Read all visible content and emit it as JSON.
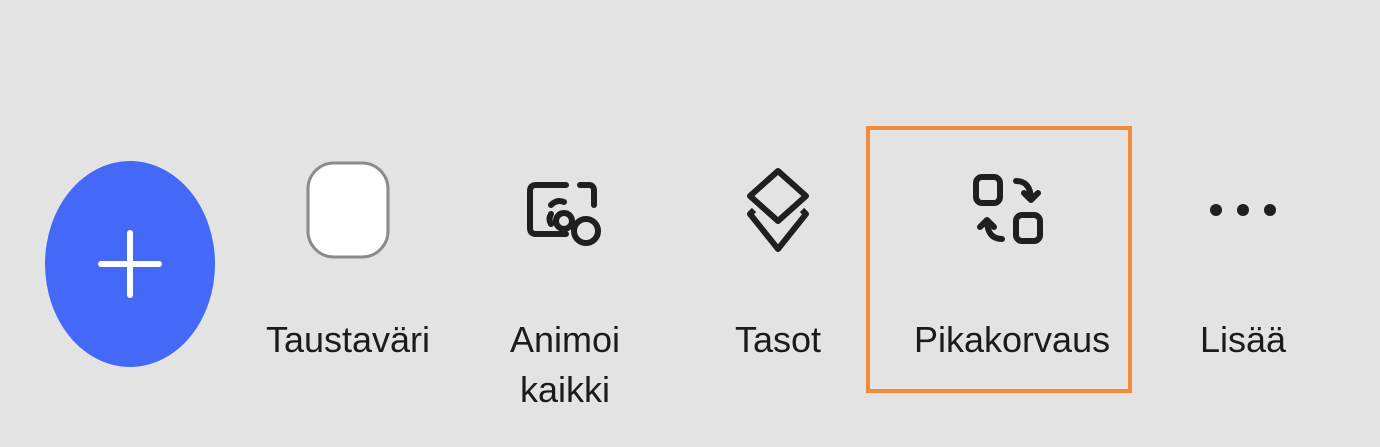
{
  "colors": {
    "background": "#e3e3e3",
    "add_button": "#4468f7",
    "highlight": "#f38a3a",
    "icon": "#1f1f1f"
  },
  "add_button": {
    "icon": "plus-icon"
  },
  "toolbar": {
    "items": [
      {
        "label_lines": [
          "Taustaväri"
        ],
        "icon": "color-swatch-icon"
      },
      {
        "label_lines": [
          "Animoi",
          "kaikki"
        ],
        "icon": "animate-all-icon"
      },
      {
        "label_lines": [
          "Tasot"
        ],
        "icon": "layers-icon"
      },
      {
        "label_lines": [
          "Pikakorvaus"
        ],
        "icon": "quick-replace-icon"
      },
      {
        "label_lines": [
          "Lisää"
        ],
        "icon": "more-dots-icon"
      }
    ]
  }
}
